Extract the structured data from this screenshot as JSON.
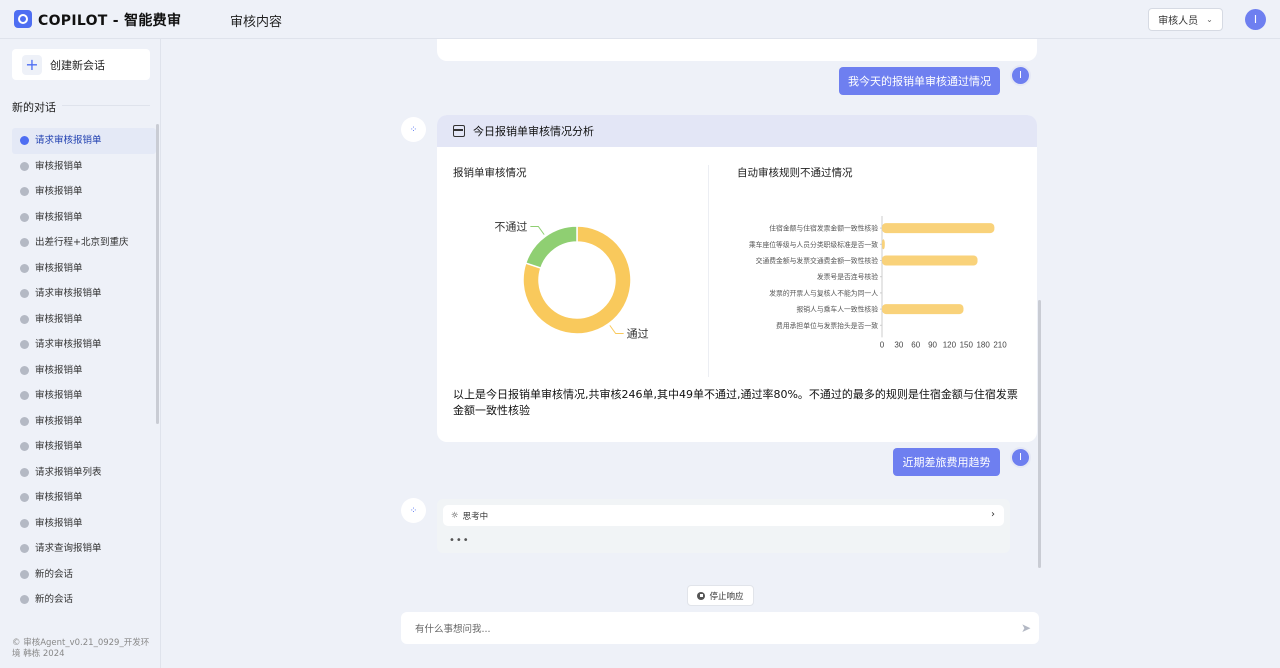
{
  "app": {
    "title": "COPILOT  - 智能费审",
    "header_title": "审核内容",
    "role_select": "审核人员",
    "user_initial": "I"
  },
  "sidebar": {
    "new_chat_label": "创建新会话",
    "section_label": "新的对话",
    "items": [
      "请求审核报销单",
      "审核报销单",
      "审核报销单",
      "审核报销单",
      "出差行程+北京到重庆",
      "审核报销单",
      "请求审核报销单",
      "审核报销单",
      "请求审核报销单",
      "审核报销单",
      "审核报销单",
      "审核报销单",
      "审核报销单",
      "请求报销单列表",
      "审核报销单",
      "审核报销单",
      "请求查询报销单",
      "新的会话",
      "新的会话"
    ],
    "footer": "© 审核Agent_v0.21_0929_开发环境 韩栋 2024"
  },
  "chat": {
    "user_msg_1": "我今天的报销单审核通过情况",
    "user_msg_2": "近期差旅费用趋势",
    "card_title": "今日报销单审核情况分析",
    "panel_left_title": "报销单审核情况",
    "panel_right_title": "自动审核规则不通过情况",
    "summary": "以上是今日报销单审核情况,共审核246单,其中49单不通过,通过率80%。不通过的最多的规则是住宿金额与住宿发票金额一致性核验",
    "thinking_label": "思考中",
    "stop_label": "停止响应",
    "input_placeholder": "有什么事想问我..."
  },
  "chart_data": [
    {
      "type": "pie",
      "title": "报销单审核情况",
      "labels": [
        "通过",
        "不通过"
      ],
      "values": [
        197,
        49
      ],
      "colors": [
        "#f9c95c",
        "#8fcf72"
      ]
    },
    {
      "type": "bar",
      "orientation": "horizontal",
      "title": "自动审核规则不通过情况",
      "categories": [
        "住宿金额与住宿发票金额一致性核验",
        "乘车座位等级与人员分类职级标准是否一致",
        "交通费金额与发票交通费金额一致性核验",
        "发票号是否连号核验",
        "发票的开票人与复核人不能为同一人",
        "报销人与乘车人一致性核验",
        "费用承担单位与发票抬头是否一致"
      ],
      "values": [
        200,
        5,
        170,
        0,
        0,
        145,
        0
      ],
      "xticks": [
        0,
        30,
        60,
        90,
        120,
        150,
        180,
        210
      ],
      "xlim": [
        0,
        210
      ],
      "color": "#f9d27a"
    }
  ]
}
